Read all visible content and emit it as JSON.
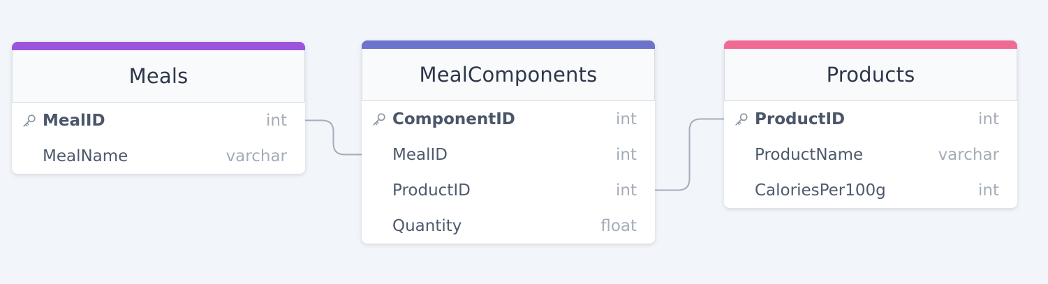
{
  "colors": {
    "background": "#f2f5f9",
    "edge": "#a3adbd"
  },
  "tables": [
    {
      "id": "meals",
      "name": "Meals",
      "accent": "#9b55dc",
      "columns": [
        {
          "name": "MealID",
          "type": "int",
          "pk": true
        },
        {
          "name": "MealName",
          "type": "varchar",
          "pk": false
        }
      ]
    },
    {
      "id": "meal-components",
      "name": "MealComponents",
      "accent": "#6c73cc",
      "columns": [
        {
          "name": "ComponentID",
          "type": "int",
          "pk": true
        },
        {
          "name": "MealID",
          "type": "int",
          "pk": false
        },
        {
          "name": "ProductID",
          "type": "int",
          "pk": false
        },
        {
          "name": "Quantity",
          "type": "float",
          "pk": false
        }
      ]
    },
    {
      "id": "products",
      "name": "Products",
      "accent": "#f06b93",
      "columns": [
        {
          "name": "ProductID",
          "type": "int",
          "pk": true
        },
        {
          "name": "ProductName",
          "type": "varchar",
          "pk": false
        },
        {
          "name": "CaloriesPer100g",
          "type": "int",
          "pk": false
        }
      ]
    }
  ],
  "relations": [
    {
      "from": {
        "table": "meals",
        "column": "MealID"
      },
      "to": {
        "table": "meal-components",
        "column": "MealID"
      }
    },
    {
      "from": {
        "table": "meal-components",
        "column": "ProductID"
      },
      "to": {
        "table": "products",
        "column": "ProductID"
      }
    }
  ]
}
